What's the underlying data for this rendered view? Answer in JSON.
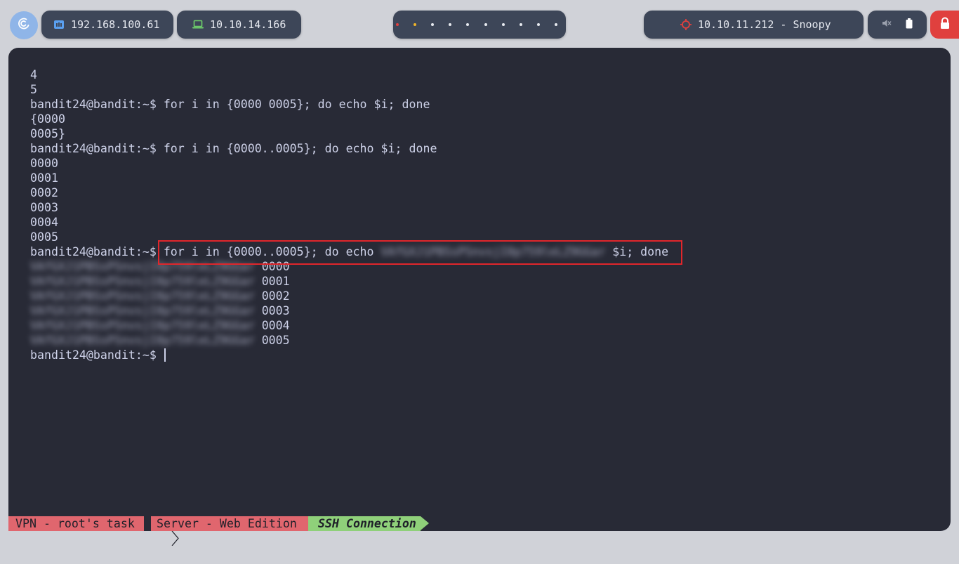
{
  "topbar": {
    "ip_ethernet": "192.168.100.61",
    "ip_vpn": "10.10.14.166",
    "target": "10.10.11.212 - Snoopy",
    "workspace_dot_colors": [
      "#e0403e",
      "#f0b429",
      "#e7eaf0",
      "#e7eaf0",
      "#e7eaf0",
      "#e7eaf0",
      "#e7eaf0",
      "#e7eaf0",
      "#e7eaf0",
      "#e7eaf0"
    ],
    "icons": {
      "logo": "debian-swirl-icon",
      "ethernet": "ethernet-icon",
      "vpn": "laptop-icon",
      "target": "crosshair-icon",
      "sound": "mute-icon",
      "battery": "battery-icon",
      "lock": "lock-icon"
    }
  },
  "terminal": {
    "prompt": "bandit24@bandit:~$",
    "lines": [
      {
        "type": "out",
        "text": "4"
      },
      {
        "type": "out",
        "text": "5"
      },
      {
        "type": "cmd",
        "text": " for i in {0000 0005}; do echo $i; done"
      },
      {
        "type": "out",
        "text": "{0000"
      },
      {
        "type": "out",
        "text": "0005}"
      },
      {
        "type": "cmd",
        "text": " for i in {0000..0005}; do echo $i; done"
      },
      {
        "type": "out",
        "text": "0000"
      },
      {
        "type": "out",
        "text": "0001"
      },
      {
        "type": "out",
        "text": "0002"
      },
      {
        "type": "out",
        "text": "0003"
      },
      {
        "type": "out",
        "text": "0004"
      },
      {
        "type": "out",
        "text": "0005"
      },
      {
        "type": "cmd_blur",
        "before": " for i in {0000..0005}; do echo ",
        "blurred": "VAfGXJ1PBSsPSnvsjI8p759leLZ9GGar",
        "after": " $i; done"
      },
      {
        "type": "blur_out",
        "blurred": "VAfGXJ1PBSsPSnvsjI8p759leLZ9GGar",
        "after": " 0000"
      },
      {
        "type": "blur_out",
        "blurred": "VAfGXJ1PBSsPSnvsjI8p759leLZ9GGar",
        "after": " 0001"
      },
      {
        "type": "blur_out",
        "blurred": "VAfGXJ1PBSsPSnvsjI8p759leLZ9GGar",
        "after": " 0002"
      },
      {
        "type": "blur_out",
        "blurred": "VAfGXJ1PBSsPSnvsjI8p759leLZ9GGar",
        "after": " 0003"
      },
      {
        "type": "blur_out",
        "blurred": "VAfGXJ1PBSsPSnvsjI8p759leLZ9GGar",
        "after": " 0004"
      },
      {
        "type": "blur_out",
        "blurred": "VAfGXJ1PBSsPSnvsjI8p759leLZ9GGar",
        "after": " 0005"
      },
      {
        "type": "prompt_cursor",
        "text": " "
      }
    ],
    "highlight_color": "#e1262b"
  },
  "statusbar": {
    "seg1": "VPN - root's task",
    "seg2": "Server - Web Edition",
    "seg3": "SSH Connection",
    "seg_colors": [
      "#e0666e",
      "#e0666e",
      "#8fd07a"
    ]
  }
}
